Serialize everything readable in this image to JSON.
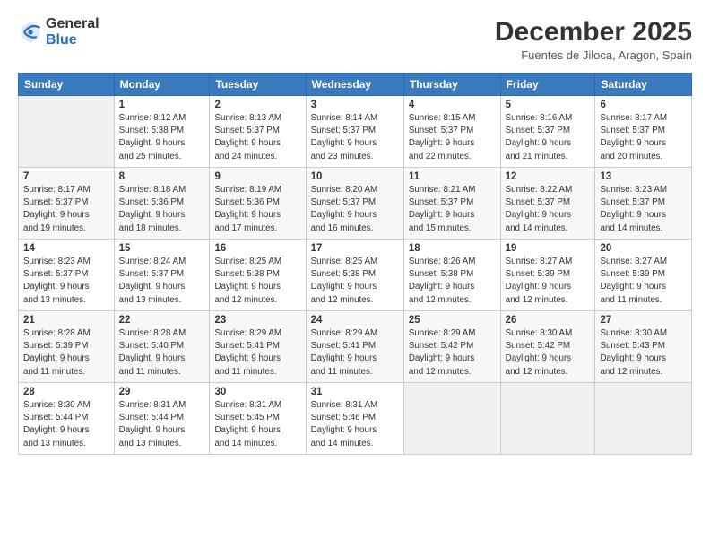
{
  "logo": {
    "general": "General",
    "blue": "Blue"
  },
  "header": {
    "month": "December 2025",
    "location": "Fuentes de Jiloca, Aragon, Spain"
  },
  "weekdays": [
    "Sunday",
    "Monday",
    "Tuesday",
    "Wednesday",
    "Thursday",
    "Friday",
    "Saturday"
  ],
  "weeks": [
    [
      {
        "day": "",
        "info": ""
      },
      {
        "day": "1",
        "info": "Sunrise: 8:12 AM\nSunset: 5:38 PM\nDaylight: 9 hours\nand 25 minutes."
      },
      {
        "day": "2",
        "info": "Sunrise: 8:13 AM\nSunset: 5:37 PM\nDaylight: 9 hours\nand 24 minutes."
      },
      {
        "day": "3",
        "info": "Sunrise: 8:14 AM\nSunset: 5:37 PM\nDaylight: 9 hours\nand 23 minutes."
      },
      {
        "day": "4",
        "info": "Sunrise: 8:15 AM\nSunset: 5:37 PM\nDaylight: 9 hours\nand 22 minutes."
      },
      {
        "day": "5",
        "info": "Sunrise: 8:16 AM\nSunset: 5:37 PM\nDaylight: 9 hours\nand 21 minutes."
      },
      {
        "day": "6",
        "info": "Sunrise: 8:17 AM\nSunset: 5:37 PM\nDaylight: 9 hours\nand 20 minutes."
      }
    ],
    [
      {
        "day": "7",
        "info": "Sunrise: 8:17 AM\nSunset: 5:37 PM\nDaylight: 9 hours\nand 19 minutes."
      },
      {
        "day": "8",
        "info": "Sunrise: 8:18 AM\nSunset: 5:36 PM\nDaylight: 9 hours\nand 18 minutes."
      },
      {
        "day": "9",
        "info": "Sunrise: 8:19 AM\nSunset: 5:36 PM\nDaylight: 9 hours\nand 17 minutes."
      },
      {
        "day": "10",
        "info": "Sunrise: 8:20 AM\nSunset: 5:37 PM\nDaylight: 9 hours\nand 16 minutes."
      },
      {
        "day": "11",
        "info": "Sunrise: 8:21 AM\nSunset: 5:37 PM\nDaylight: 9 hours\nand 15 minutes."
      },
      {
        "day": "12",
        "info": "Sunrise: 8:22 AM\nSunset: 5:37 PM\nDaylight: 9 hours\nand 14 minutes."
      },
      {
        "day": "13",
        "info": "Sunrise: 8:23 AM\nSunset: 5:37 PM\nDaylight: 9 hours\nand 14 minutes."
      }
    ],
    [
      {
        "day": "14",
        "info": "Sunrise: 8:23 AM\nSunset: 5:37 PM\nDaylight: 9 hours\nand 13 minutes."
      },
      {
        "day": "15",
        "info": "Sunrise: 8:24 AM\nSunset: 5:37 PM\nDaylight: 9 hours\nand 13 minutes."
      },
      {
        "day": "16",
        "info": "Sunrise: 8:25 AM\nSunset: 5:38 PM\nDaylight: 9 hours\nand 12 minutes."
      },
      {
        "day": "17",
        "info": "Sunrise: 8:25 AM\nSunset: 5:38 PM\nDaylight: 9 hours\nand 12 minutes."
      },
      {
        "day": "18",
        "info": "Sunrise: 8:26 AM\nSunset: 5:38 PM\nDaylight: 9 hours\nand 12 minutes."
      },
      {
        "day": "19",
        "info": "Sunrise: 8:27 AM\nSunset: 5:39 PM\nDaylight: 9 hours\nand 12 minutes."
      },
      {
        "day": "20",
        "info": "Sunrise: 8:27 AM\nSunset: 5:39 PM\nDaylight: 9 hours\nand 11 minutes."
      }
    ],
    [
      {
        "day": "21",
        "info": "Sunrise: 8:28 AM\nSunset: 5:39 PM\nDaylight: 9 hours\nand 11 minutes."
      },
      {
        "day": "22",
        "info": "Sunrise: 8:28 AM\nSunset: 5:40 PM\nDaylight: 9 hours\nand 11 minutes."
      },
      {
        "day": "23",
        "info": "Sunrise: 8:29 AM\nSunset: 5:41 PM\nDaylight: 9 hours\nand 11 minutes."
      },
      {
        "day": "24",
        "info": "Sunrise: 8:29 AM\nSunset: 5:41 PM\nDaylight: 9 hours\nand 11 minutes."
      },
      {
        "day": "25",
        "info": "Sunrise: 8:29 AM\nSunset: 5:42 PM\nDaylight: 9 hours\nand 12 minutes."
      },
      {
        "day": "26",
        "info": "Sunrise: 8:30 AM\nSunset: 5:42 PM\nDaylight: 9 hours\nand 12 minutes."
      },
      {
        "day": "27",
        "info": "Sunrise: 8:30 AM\nSunset: 5:43 PM\nDaylight: 9 hours\nand 12 minutes."
      }
    ],
    [
      {
        "day": "28",
        "info": "Sunrise: 8:30 AM\nSunset: 5:44 PM\nDaylight: 9 hours\nand 13 minutes."
      },
      {
        "day": "29",
        "info": "Sunrise: 8:31 AM\nSunset: 5:44 PM\nDaylight: 9 hours\nand 13 minutes."
      },
      {
        "day": "30",
        "info": "Sunrise: 8:31 AM\nSunset: 5:45 PM\nDaylight: 9 hours\nand 14 minutes."
      },
      {
        "day": "31",
        "info": "Sunrise: 8:31 AM\nSunset: 5:46 PM\nDaylight: 9 hours\nand 14 minutes."
      },
      {
        "day": "",
        "info": ""
      },
      {
        "day": "",
        "info": ""
      },
      {
        "day": "",
        "info": ""
      }
    ]
  ]
}
